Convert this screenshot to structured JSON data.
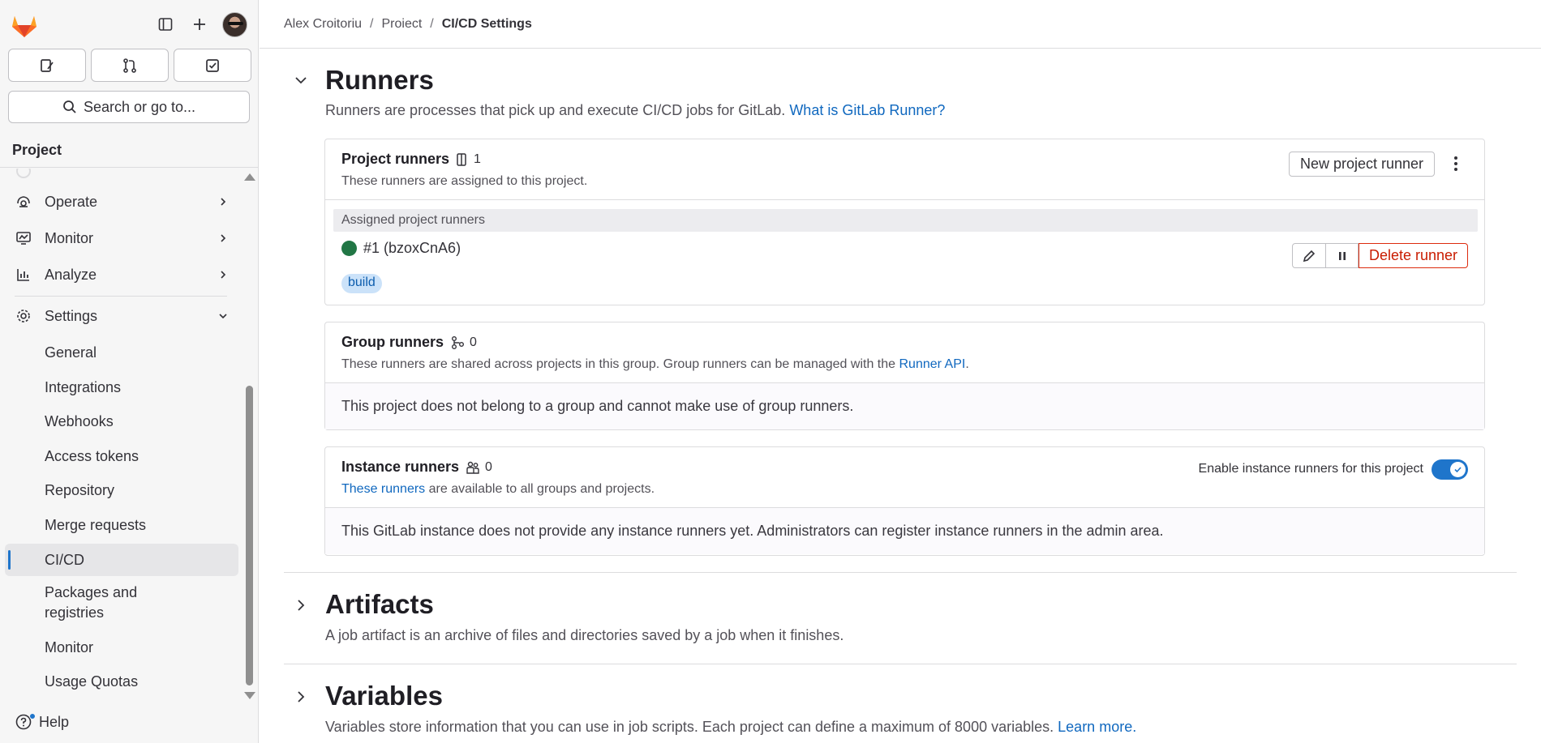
{
  "sidebar": {
    "quick_actions": [
      "issues-icon",
      "merge-requests-icon",
      "todo-icon"
    ],
    "search_label": "Search or go to...",
    "project_label": "Project",
    "nav": [
      {
        "label": "Operate",
        "icon": "deployments-icon"
      },
      {
        "label": "Monitor",
        "icon": "monitor-icon"
      },
      {
        "label": "Analyze",
        "icon": "chart-icon"
      },
      {
        "label": "Settings",
        "icon": "settings-icon"
      }
    ],
    "settings_items": [
      {
        "label": "General"
      },
      {
        "label": "Integrations"
      },
      {
        "label": "Webhooks"
      },
      {
        "label": "Access tokens"
      },
      {
        "label": "Repository"
      },
      {
        "label": "Merge requests"
      },
      {
        "label": "CI/CD",
        "active": true
      },
      {
        "label": "Packages and registries"
      },
      {
        "label": "Monitor"
      },
      {
        "label": "Usage Quotas"
      }
    ],
    "help_label": "Help"
  },
  "breadcrumb": {
    "user": "Alex Croitoriu",
    "project": "Proiect",
    "current": "CI/CD Settings"
  },
  "runners": {
    "title": "Runners",
    "desc": "Runners are processes that pick up and execute CI/CD jobs for GitLab.",
    "desc_link": "What is GitLab Runner?",
    "project": {
      "title": "Project runners",
      "count": "1",
      "desc": "These runners are assigned to this project.",
      "new_button": "New project runner",
      "assigned_label": "Assigned project runners",
      "runner_name": "#1 (bzoxCnA6)",
      "runner_status_color": "#217645",
      "tag": "build",
      "delete_button": "Delete runner"
    },
    "group": {
      "title": "Group runners",
      "count": "0",
      "desc": "These runners are shared across projects in this group. Group runners can be managed with the",
      "desc_link": "Runner API",
      "desc_end": ".",
      "body": "This project does not belong to a group and cannot make use of group runners."
    },
    "instance": {
      "title": "Instance runners",
      "count": "0",
      "desc_link": "These runners",
      "desc": "are available to all groups and projects.",
      "toggle_label": "Enable instance runners for this project",
      "toggle_on": true,
      "body": "This GitLab instance does not provide any instance runners yet. Administrators can register instance runners in the admin area."
    }
  },
  "artifacts": {
    "title": "Artifacts",
    "desc": "A job artifact is an archive of files and directories saved by a job when it finishes."
  },
  "variables": {
    "title": "Variables",
    "desc": "Variables store information that you can use in job scripts. Each project can define a maximum of 8000 variables.",
    "desc_link": "Learn more."
  },
  "colors": {
    "accent": "#1f75cb",
    "link": "#1068bf",
    "danger": "#dd2b0e",
    "sidebar_bg": "#f6f6f6"
  }
}
